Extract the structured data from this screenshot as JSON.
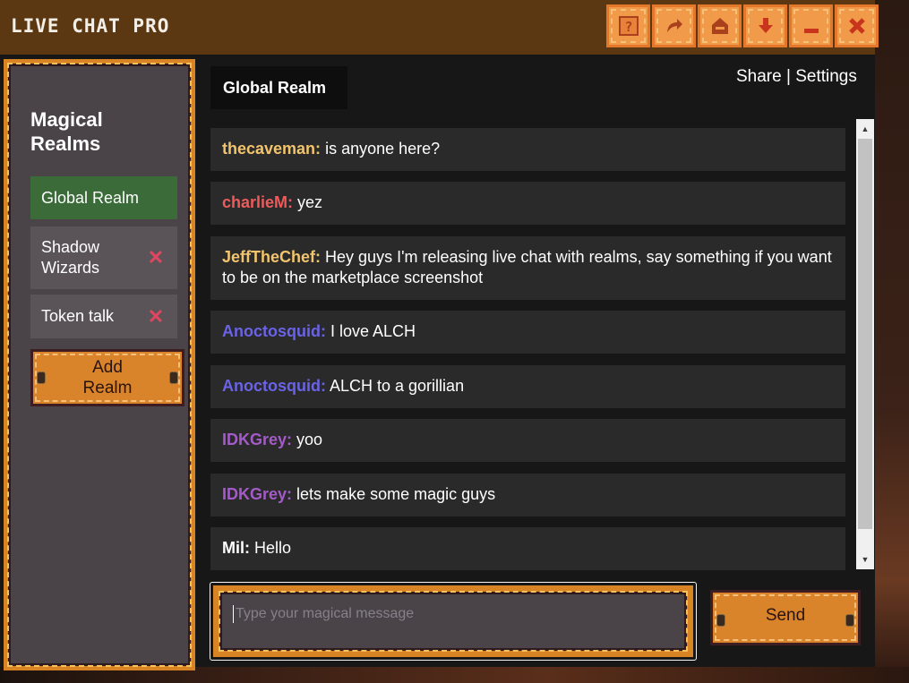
{
  "app": {
    "title": "LIVE CHAT PRO"
  },
  "titlebar_buttons": [
    {
      "name": "help-icon",
      "color": "#a9411c"
    },
    {
      "name": "share-arrow-icon",
      "color": "#a9411c"
    },
    {
      "name": "home-icon",
      "color": "#a9411c"
    },
    {
      "name": "download-icon",
      "color": "#c8341c"
    },
    {
      "name": "minimize-icon",
      "color": "#c8341c"
    },
    {
      "name": "close-icon",
      "color": "#c8341c"
    }
  ],
  "sidebar": {
    "title": "Magical Realms",
    "realms": [
      {
        "label": "Global Realm",
        "active": true,
        "deletable": false
      },
      {
        "label": "Shadow Wizards",
        "active": false,
        "deletable": true
      },
      {
        "label": "Token talk",
        "active": false,
        "deletable": true
      }
    ],
    "add_label": "Add Realm",
    "delete_glyph": "✕"
  },
  "header": {
    "channel": "Global Realm",
    "share_label": "Share",
    "separator": "|",
    "settings_label": "Settings"
  },
  "messages": [
    {
      "user": "thecaveman:",
      "text": "is anyone here?",
      "color": "#f2c46d"
    },
    {
      "user": "charlieM:",
      "text": "yez",
      "color": "#ee5b5b"
    },
    {
      "user": "JeffTheChef:",
      "text": "Hey guys I'm releasing live chat with realms, say something if you want to be on the marketplace screenshot",
      "color": "#f2c46d"
    },
    {
      "user": "Anoctosquid:",
      "text": "I love ALCH",
      "color": "#6a63e8"
    },
    {
      "user": "Anoctosquid:",
      "text": "ALCH to a gorillian",
      "color": "#6a63e8"
    },
    {
      "user": "IDKGrey:",
      "text": "yoo",
      "color": "#a45bc8"
    },
    {
      "user": "IDKGrey:",
      "text": "lets make some magic guys",
      "color": "#a45bc8"
    },
    {
      "user": "Mil:",
      "text": "Hello",
      "color": "#ffffff"
    }
  ],
  "composer": {
    "placeholder": "Type your magical message",
    "send_label": "Send"
  },
  "colors": {
    "titlebar": "#5b3812",
    "wood": "#d98424",
    "panel": "#4a4448",
    "active_realm": "#3a6b39",
    "message_bg": "#2a2a2a"
  }
}
